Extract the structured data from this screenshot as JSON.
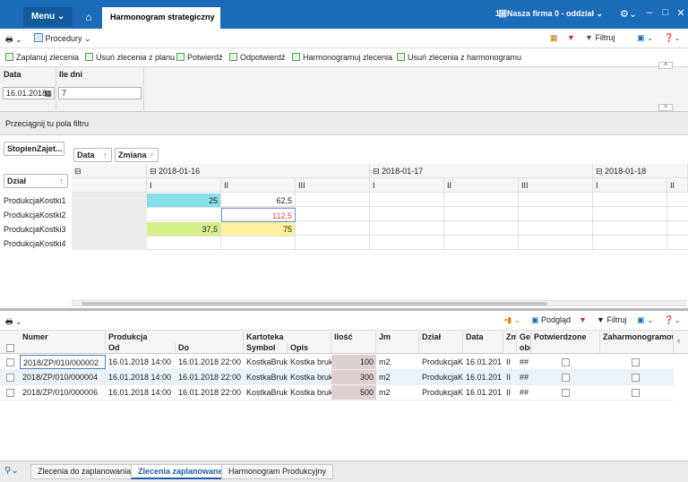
{
  "titlebar": {
    "menu": "Menu",
    "active_tab": "Harmonogram strategiczny",
    "firm": "1 - Nasza firma 0 - oddział"
  },
  "toolbar1": {
    "procedures": "Procedury",
    "filter": "Filtruj"
  },
  "actions": [
    "Zaplanuj zlecenia",
    "Usuń zlecenia z planu",
    "Potwierdź",
    "Odpotwierdź",
    "Harmonogramuj zlecenia",
    "Usuń zlecenia z harmonogramu"
  ],
  "filters": {
    "date_label": "Data",
    "date_value": "16.01.2018",
    "days_label": "Ile dni",
    "days_value": "7"
  },
  "drag_hint": "Przeciągnij tu pola filtru",
  "pivot": {
    "filter_chip": "StopienZajet...",
    "col_chips": [
      "Data",
      "Zmiana"
    ],
    "row_chip": "Dział",
    "dates": [
      "2018-01-16",
      "2018-01-17",
      "2018-01-18"
    ],
    "shifts": [
      "I",
      "II",
      "III",
      "I",
      "II",
      "III",
      "I",
      "II"
    ],
    "rows": [
      "ProdukcjaKostki1",
      "ProdukcjaKostki2",
      "ProdukcjaKostki3",
      "ProdukcjaKostki4"
    ],
    "cells": {
      "r1c1": "25",
      "r1c2": "62,5",
      "r2c2": "112,5",
      "r3c1": "37,5",
      "r3c2": "75"
    }
  },
  "lower_toolbar": {
    "preview": "Podgląd",
    "filter": "Filtruj"
  },
  "lower_grid": {
    "headers": {
      "numer": "Numer",
      "produkcja": "Produkcja",
      "od": "Od",
      "do": "Do",
      "kartoteka": "Kartoteka",
      "symbol": "Symbol",
      "opis": "Opis",
      "ilosc": "Ilość",
      "jm": "Jm",
      "dzial": "Dział",
      "data": "Data",
      "zm": "Zm",
      "ge1": "Ge",
      "ge2": "obc",
      "potwierdzone": "Potwierdzone",
      "zaharm": "Zaharmonogramow"
    },
    "rows": [
      {
        "numer": "2018/ZP/010/000002",
        "od": "16.01.2018 14:00",
        "do": "16.01.2018 22:00",
        "symbol": "KostkaBruk",
        "opis": "Kostka bruk",
        "ilosc": "100",
        "jm": "m2",
        "dzial": "ProdukcjaK",
        "data": "16.01.201",
        "zm": "II",
        "ge": "##"
      },
      {
        "numer": "2018/ZP/010/000004",
        "od": "16.01.2018 14:00",
        "do": "16.01.2018 22:00",
        "symbol": "KostkaBruk",
        "opis": "Kostka bruk",
        "ilosc": "300",
        "jm": "m2",
        "dzial": "ProdukcjaK",
        "data": "16.01.201",
        "zm": "II",
        "ge": "##"
      },
      {
        "numer": "2018/ZP/010/000006",
        "od": "16.01.2018 14:00",
        "do": "16.01.2018 22:00",
        "symbol": "KostkaBruk",
        "opis": "Kostka bruk",
        "ilosc": "500",
        "jm": "m2",
        "dzial": "ProdukcjaK",
        "data": "16.01.201",
        "zm": "II",
        "ge": "##"
      }
    ]
  },
  "bottom_tabs": [
    "Zlecenia do zaplanowania",
    "Zlecenia zaplanowane",
    "Harmonogram Produkcyjny"
  ],
  "colors": {
    "accent": "#1a6bb8",
    "cyan": "#86dfe8",
    "green": "#d4f08a",
    "yellow": "#fdf0a0",
    "red": "#e0434b"
  }
}
